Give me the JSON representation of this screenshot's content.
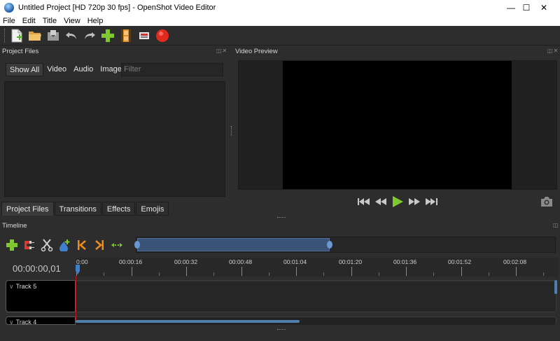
{
  "window": {
    "title": "Untitled Project [HD 720p 30 fps] - OpenShot Video Editor",
    "controls": {
      "minimize": "—",
      "maximize": "☐",
      "close": "✕"
    }
  },
  "menu": [
    "File",
    "Edit",
    "Title",
    "View",
    "Help"
  ],
  "toolbar": {
    "icons": [
      "new-project-icon",
      "open-project-icon",
      "save-project-icon",
      "undo-icon",
      "redo-icon",
      "import-files-icon",
      "profile-icon",
      "fullscreen-icon",
      "export-video-icon"
    ]
  },
  "project_files": {
    "title": "Project Files",
    "filter_tabs": [
      "Show All",
      "Video",
      "Audio",
      "Image"
    ],
    "filter_placeholder": "Filter",
    "dock_buttons": "◫✕"
  },
  "bottom_tabs": [
    "Project Files",
    "Transitions",
    "Effects",
    "Emojis"
  ],
  "video_preview": {
    "title": "Video Preview",
    "dock_buttons": "◫✕",
    "controls": [
      "jump-to-start-icon",
      "rewind-icon",
      "play-icon",
      "fast-forward-icon",
      "jump-to-end-icon"
    ],
    "snapshot_icon": "camera-icon"
  },
  "timeline": {
    "title": "Timeline",
    "dock_buttons": "◫",
    "toolbar_icons": [
      "add-track-icon",
      "snapping-icon",
      "razor-icon",
      "add-marker-icon",
      "previous-marker-icon",
      "next-marker-icon",
      "center-playhead-icon"
    ],
    "zoom_fraction": 0.46,
    "timecode": "00:00:00,01",
    "ruler_labels": [
      "0:00",
      "00:00:16",
      "00:00:32",
      "00:00:48",
      "00:01:04",
      "00:01:20",
      "00:01:36",
      "00:01:52",
      "00:02:08"
    ],
    "tracks": [
      "Track 5",
      "Track 4"
    ]
  },
  "colors": {
    "background": "#2d2d2d",
    "accent_blue": "#4f7fae",
    "playhead": "#c01818",
    "add_green": "#7ec832",
    "record_red": "#e02a1e"
  }
}
